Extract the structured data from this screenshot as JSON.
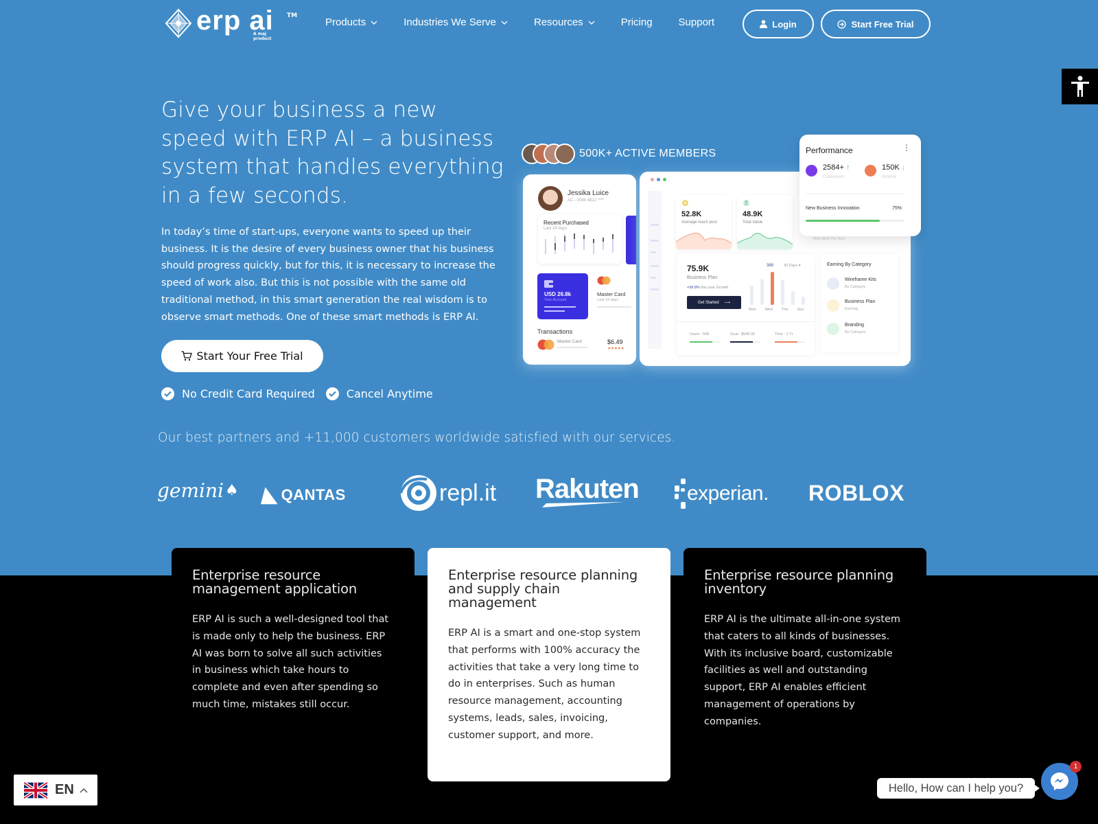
{
  "header": {
    "logo_text": "erp ai",
    "logo_tm": "TM",
    "logo_tagline": "A maj product",
    "nav": [
      {
        "label": "Products",
        "has_dropdown": true
      },
      {
        "label": "Industries We Serve",
        "has_dropdown": true
      },
      {
        "label": "Resources",
        "has_dropdown": true
      },
      {
        "label": "Pricing",
        "has_dropdown": false
      },
      {
        "label": "Support",
        "has_dropdown": false
      }
    ],
    "login_label": "Login",
    "trial_label": "Start Free Trial"
  },
  "accessibility": {
    "icon": "accessibility-icon"
  },
  "hero": {
    "title": "Give your business a new speed with ERP AI – a business system that handles everything in a few seconds.",
    "description": "In today’s time of start-ups, everyone wants to speed up their business. It is the desire of every business owner that his business should progress quickly, but for this, it is necessary to increase the speed of work also. But this is not possible with the same old traditional method, in this smart generation the real wisdom is to observe smart methods. One of these smart methods is ERP AI.",
    "cta_label": "Start Your Free Trial",
    "checks": [
      "No Credit Card Required",
      "Cancel Anytime"
    ]
  },
  "dashboard": {
    "members_label": "500K+ ACTIVE MEMBERS",
    "profile": {
      "name": "Jessika Luice",
      "account": "AC - 2084 4822 ****"
    },
    "recent_purchased": {
      "title": "Recent Purchased",
      "subtitle": "Last 24 days"
    },
    "account_card": {
      "amount": "USD 26.8k",
      "label": "Your Account"
    },
    "master_card": {
      "title": "Master Card",
      "subtitle": "Last 24 days"
    },
    "transactions": {
      "title": "Transactions",
      "item": "Master Card",
      "amount": "$6.49"
    },
    "stat1": {
      "value": "52.8K",
      "label": "Average reach post"
    },
    "stat2": {
      "value": "48.9K",
      "label": "Total Value"
    },
    "business": {
      "value": "75.9K",
      "label": "Business Plan",
      "growth_pct": "+58.8%",
      "growth_text": "this year Growth",
      "button": "Get Started",
      "peak": "389",
      "range": "30 Days",
      "days": [
        "Mon",
        "Wed",
        "Thu",
        "Sun"
      ],
      "footer": [
        {
          "label": "Users : 50K",
          "progress": 0.75,
          "color": "#5bc46a"
        },
        {
          "label": "Goal : $545.00",
          "progress": 0.75,
          "color": "#1b2340"
        },
        {
          "label": "Time : 2 Yr",
          "progress": 0.75,
          "color": "#e9825a"
        }
      ]
    },
    "earning": {
      "title": "Earning By Category",
      "items": [
        {
          "title": "Wireframe Kits",
          "sub": "By Category"
        },
        {
          "title": "Business Plan",
          "sub": "Earning"
        },
        {
          "title": "Branding",
          "sub": "By Category"
        }
      ]
    },
    "performance": {
      "title": "Performance",
      "customers_value": "2584+",
      "customers_label": "Customers",
      "income_value": "150K",
      "income_label": "Income",
      "innovation_label": "New Business Innovation",
      "innovation_pct": "75%",
      "innovation_progress": 0.75,
      "behind_days": "Mon  Wed  Thu  Sun"
    }
  },
  "partners": {
    "text": "Our best partners and +11,000 customers worldwide satisfied with our services.",
    "logos": [
      "gemini",
      "QANTAS",
      "repl.it",
      "Rakuten",
      "experian.",
      "ROBLOX"
    ]
  },
  "features": [
    {
      "title": "Enterprise resource management application",
      "body": "ERP AI is such a well-designed tool that is made only to help the business. ERP AI was born to solve all such activities in business which take hours to complete and even after spending so much time, mistakes still occur."
    },
    {
      "title": "Enterprise resource planning and supply chain management",
      "body": "ERP AI is a smart and one-stop system that performs with 100% accuracy the activities that take a very long time to do in enterprises. Such as  human resource management, accounting systems, leads, sales, invoicing, customer support, and more."
    },
    {
      "title": "Enterprise resource planning inventory",
      "body": "ERP AI is the ultimate all-in-one system that caters to all kinds of businesses. With its inclusive board, customizable facilities as well and outstanding support, ERP AI enables efficient management of operations by companies."
    }
  ],
  "language": {
    "code": "EN"
  },
  "chat": {
    "greeting": "Hello, How can I help you?",
    "badge": "1"
  }
}
